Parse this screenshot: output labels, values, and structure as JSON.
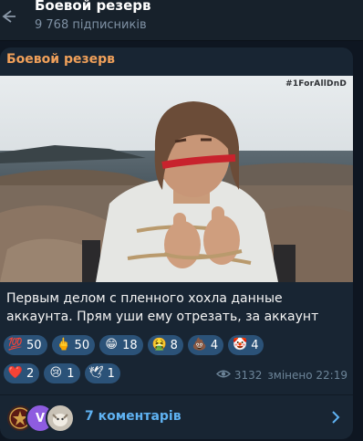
{
  "header": {
    "title": "Боевой резерв",
    "subscribers": "9 768 підписників"
  },
  "post": {
    "author": "Боевой резерв",
    "media_watermark": "#1ForAllDnD",
    "text": "Первым делом с пленного хохла данные аккаунта. Прям уши ему отрезать, за аккаунт",
    "reactions_row1": [
      {
        "emoji": "💯",
        "icon": "hundred-points-icon",
        "count": "50"
      },
      {
        "emoji": "🖕",
        "icon": "middle-finger-icon",
        "count": "50"
      },
      {
        "emoji": "😁",
        "icon": "grinning-face-icon",
        "count": "18"
      },
      {
        "emoji": "🤮",
        "icon": "vomiting-face-icon",
        "count": "8"
      },
      {
        "emoji": "💩",
        "icon": "pile-of-poo-icon",
        "count": "4"
      },
      {
        "emoji": "🤡",
        "icon": "clown-face-icon",
        "count": "4"
      }
    ],
    "reactions_row2": [
      {
        "emoji": "❤️",
        "icon": "red-heart-icon",
        "count": "2"
      },
      {
        "emoji": "😢",
        "icon": "crying-face-icon",
        "count": "1"
      },
      {
        "emoji": "🕊",
        "icon": "dove-icon",
        "count": "1"
      }
    ],
    "views": "3132",
    "edited": "змінено 22:19"
  },
  "comments": {
    "label": "7 коментарів",
    "avatars": [
      "emblem-avatar",
      "V",
      "animal-avatar"
    ]
  },
  "colors": {
    "background": "#0e1621",
    "bubble": "#182533",
    "header": "#17212b",
    "author": "#f0a05a",
    "reaction_chip": "#2b5278",
    "link": "#5fb2f2",
    "muted": "#6d8599"
  }
}
